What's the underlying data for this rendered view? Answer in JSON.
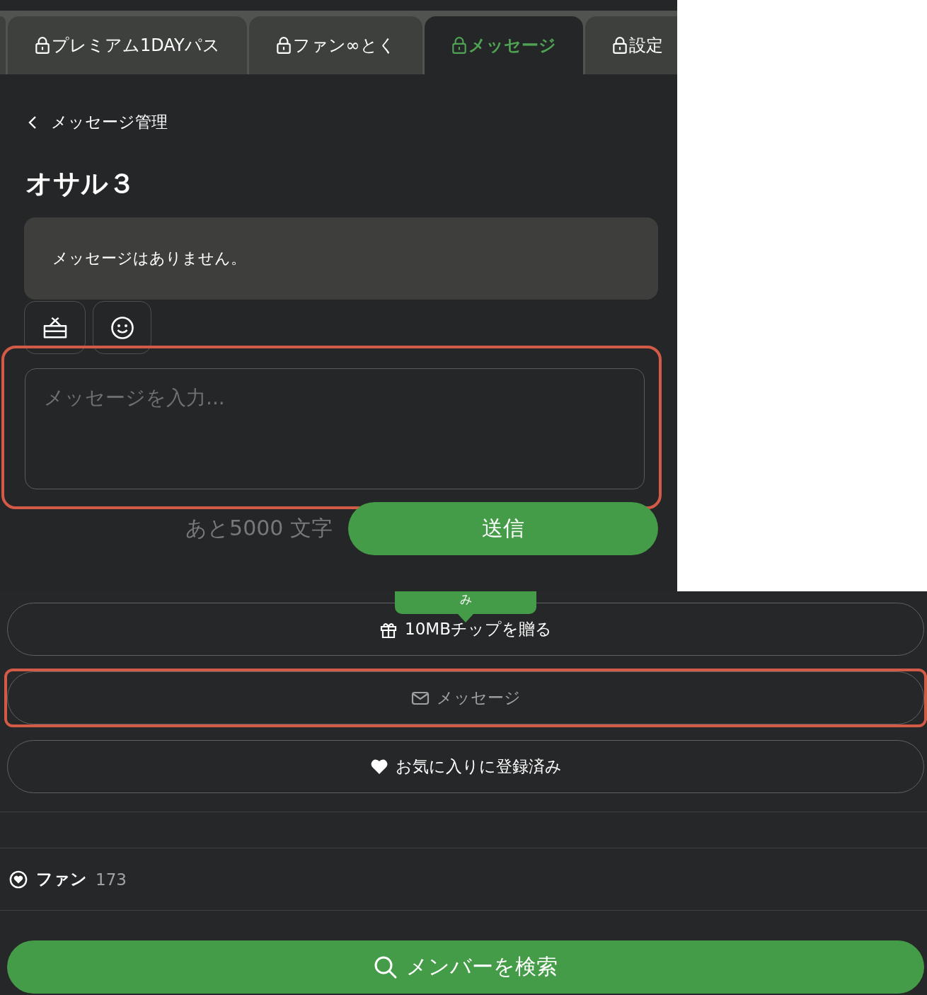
{
  "tabs": [
    {
      "label": "プレミアム1DAYパス",
      "locked": true,
      "selected": false
    },
    {
      "label": "ファン∞とく",
      "locked": true,
      "selected": false
    },
    {
      "label": "メッセージ",
      "locked": true,
      "selected": true
    },
    {
      "label": "設定",
      "locked": true,
      "selected": false
    }
  ],
  "back_link": "メッセージ管理",
  "title": "オサル３",
  "messages_empty": "メッセージはありません。",
  "composer": {
    "placeholder": "メッセージを入力...",
    "highlighted": true,
    "remaining": "あと5000 文字",
    "send": "送信"
  },
  "tooltip": "み",
  "actions": [
    {
      "kind": "gift",
      "label": "10MBチップを贈る",
      "disabled": false,
      "highlighted": false
    },
    {
      "kind": "message",
      "label": "メッセージ",
      "disabled": true,
      "highlighted": true
    },
    {
      "kind": "favorite",
      "label": "お気に入りに登録済み",
      "disabled": false,
      "highlighted": false
    }
  ],
  "fans": {
    "label": "ファン",
    "count": "173"
  },
  "search_button": "メンバーを検索"
}
